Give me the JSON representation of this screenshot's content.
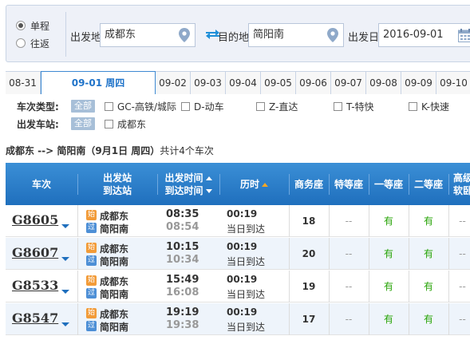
{
  "search": {
    "trip_types": [
      {
        "label": "单程",
        "selected": true
      },
      {
        "label": "往返",
        "selected": false
      }
    ],
    "from_label": "出发地",
    "from_value": "成都东",
    "to_label": "目的地",
    "to_value": "简阳南",
    "date_label": "出发日",
    "date_value": "2016-09-01"
  },
  "date_tabs": [
    {
      "label": "08-31",
      "active": false
    },
    {
      "label": "09-01 周四",
      "active": true
    },
    {
      "label": "09-02",
      "active": false
    },
    {
      "label": "09-03",
      "active": false
    },
    {
      "label": "09-04",
      "active": false
    },
    {
      "label": "09-05",
      "active": false
    },
    {
      "label": "09-06",
      "active": false
    },
    {
      "label": "09-07",
      "active": false
    },
    {
      "label": "09-08",
      "active": false
    },
    {
      "label": "09-09",
      "active": false
    },
    {
      "label": "09-10",
      "active": false
    }
  ],
  "filters": {
    "train_type_title": "车次类型:",
    "all_label": "全部",
    "train_types": [
      "GC-高铁/城际",
      "D-动车",
      "Z-直达",
      "T-特快",
      "K-快速"
    ],
    "station_title": "出发车站:",
    "stations": [
      "成都东"
    ]
  },
  "summary": {
    "route": "成都东 --> 简阳南（9月1日  周四）",
    "count": "共计4个车次"
  },
  "table": {
    "headers": {
      "train": "车次",
      "stations_top": "出发站",
      "stations_bottom": "到达站",
      "times_top": "出发时间",
      "times_bottom": "到达时间",
      "duration": "历时",
      "business": "商务座",
      "premium": "特等座",
      "first": "一等座",
      "second": "二等座",
      "high_top": "高级",
      "high_bottom": "软卧"
    },
    "badges": {
      "start": "始",
      "pass": "过"
    },
    "rows": [
      {
        "train": "G8605",
        "from": "成都东",
        "to": "简阳南",
        "dep": "08:35",
        "arr": "08:54",
        "duration": "00:19",
        "note": "当日到达",
        "business": "18",
        "premium": "--",
        "first": "有",
        "second": "有",
        "high": "--"
      },
      {
        "train": "G8607",
        "from": "成都东",
        "to": "简阳南",
        "dep": "10:15",
        "arr": "10:34",
        "duration": "00:19",
        "note": "当日到达",
        "business": "20",
        "premium": "--",
        "first": "有",
        "second": "有",
        "high": "--"
      },
      {
        "train": "G8533",
        "from": "成都东",
        "to": "简阳南",
        "dep": "15:49",
        "arr": "16:08",
        "duration": "00:19",
        "note": "当日到达",
        "business": "19",
        "premium": "--",
        "first": "有",
        "second": "有",
        "high": "--"
      },
      {
        "train": "G8547",
        "from": "成都东",
        "to": "简阳南",
        "dep": "19:19",
        "arr": "19:38",
        "duration": "00:19",
        "note": "当日到达",
        "business": "17",
        "premium": "--",
        "first": "有",
        "second": "有",
        "high": "--"
      }
    ]
  },
  "colors": {
    "header_blue": "#1f6fbd",
    "available_green": "#26a306",
    "start_badge": "#f29b38",
    "pass_badge": "#4d8fd6"
  }
}
